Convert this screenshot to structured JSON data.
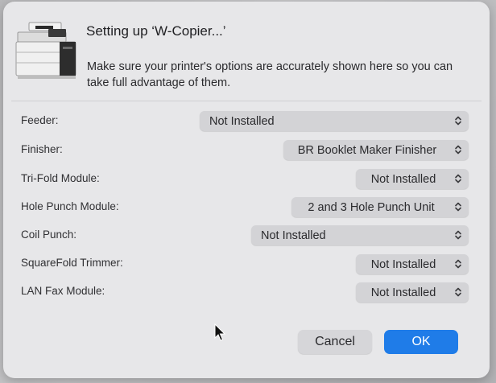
{
  "dialog": {
    "title": "Setting up ‘W-Copier...’",
    "description": "Make sure your printer's options are accurately shown here so you can take full advantage of them."
  },
  "options": [
    {
      "label": "Feeder:",
      "value": "Not Installed"
    },
    {
      "label": "Finisher:",
      "value": "BR Booklet Maker Finisher"
    },
    {
      "label": "Tri-Fold Module:",
      "value": "Not Installed"
    },
    {
      "label": "Hole Punch Module:",
      "value": "2 and 3 Hole Punch Unit"
    },
    {
      "label": "Coil Punch:",
      "value": "Not Installed"
    },
    {
      "label": "SquareFold Trimmer:",
      "value": "Not Installed"
    },
    {
      "label": "LAN Fax Module:",
      "value": "Not Installed"
    }
  ],
  "buttons": {
    "cancel": "Cancel",
    "ok": "OK"
  },
  "icons": {
    "printer": "printer-icon",
    "popup_chevron": "chevron-updown-icon",
    "cursor": "mouse-pointer-icon"
  },
  "colors": {
    "accent": "#1f7ce8",
    "sheet_background": "#e7e7e9",
    "popup_background": "#d3d3d6"
  }
}
